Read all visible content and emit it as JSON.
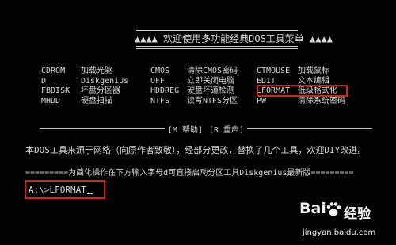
{
  "header": {
    "title": "▲▲▲▲ 欢迎使用多功能经典DOS工具菜单 ▲▲▲▲"
  },
  "menu": {
    "rows": [
      [
        {
          "cmd": "CDROM",
          "desc": "加载光驱"
        },
        {
          "cmd": "CMOS",
          "desc": "清除CMOS密码"
        },
        {
          "cmd": "CTMOUSE",
          "desc": "加载鼠标"
        }
      ],
      [
        {
          "cmd": "D",
          "desc": "Diskgenius"
        },
        {
          "cmd": "OFF",
          "desc": "立即关闭电脑"
        },
        {
          "cmd": "EDIT",
          "desc": "文本编辑"
        }
      ],
      [
        {
          "cmd": "FBDISK",
          "desc": "坏盘分区器"
        },
        {
          "cmd": "HDDREG",
          "desc": "硬盘坏道检测"
        },
        {
          "cmd": "LFORMAT",
          "desc": "低级格式化"
        }
      ],
      [
        {
          "cmd": "MHDD",
          "desc": "硬盘扫描"
        },
        {
          "cmd": "NTFS",
          "desc": "读写NTFS分区"
        },
        {
          "cmd": "PW",
          "desc": "清除系统密码"
        }
      ]
    ]
  },
  "separator": {
    "help": "[M 帮助]",
    "reboot": "[R 重启]"
  },
  "notice": "本DOS工具来源于网络（向原作者致敬），经部分更改，替换了几个工具，欢迎DIY改进。",
  "hint": "=========为简化操作在下方输入字母d可直接启动分区工具Diskgenius最新版=========",
  "prompt": {
    "text": "A:\\>LFORMAT"
  },
  "watermark": {
    "logo": "Bai",
    "name": "经验",
    "url": "jingyan.baidu.com"
  },
  "colors": {
    "background": "#020202",
    "text": "#d8d8d8",
    "highlight_box": "#c8281e"
  }
}
